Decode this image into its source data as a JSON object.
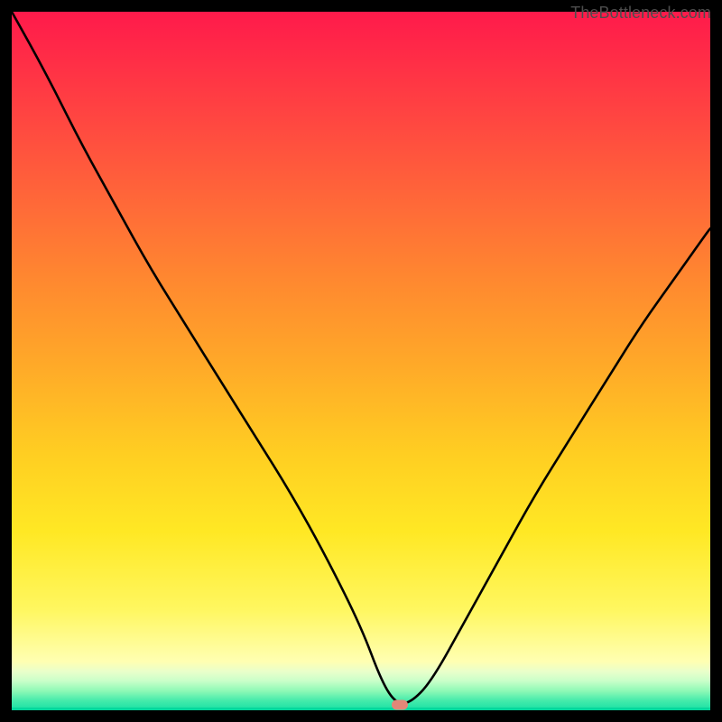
{
  "watermark": "TheBottleneck.com",
  "marker": {
    "x_pct": 55.5,
    "y_pct": 99.2,
    "color": "#e18778"
  },
  "chart_data": {
    "type": "line",
    "title": "",
    "xlabel": "",
    "ylabel": "",
    "xlim": [
      0,
      100
    ],
    "ylim": [
      0,
      100
    ],
    "grid": false,
    "legend": null,
    "series": [
      {
        "name": "bottleneck-curve",
        "x": [
          0,
          5,
          10,
          15,
          20,
          25,
          30,
          35,
          40,
          45,
          50,
          53,
          55,
          57,
          60,
          65,
          70,
          75,
          80,
          85,
          90,
          95,
          100
        ],
        "y": [
          100,
          91,
          81,
          72,
          63,
          55,
          47,
          39,
          31,
          22,
          12,
          4,
          1,
          1,
          4,
          13,
          22,
          31,
          39,
          47,
          55,
          62,
          69
        ]
      }
    ],
    "annotations": [
      {
        "type": "marker",
        "x": 55.5,
        "y": 0.8,
        "shape": "pill",
        "color": "#e18778"
      }
    ],
    "background_gradient": {
      "stops": [
        {
          "pos": 0.0,
          "color": "#ff1a4b"
        },
        {
          "pos": 0.3,
          "color": "#ff6a38"
        },
        {
          "pos": 0.55,
          "color": "#ffab28"
        },
        {
          "pos": 0.8,
          "color": "#ffe824"
        },
        {
          "pos": 0.93,
          "color": "#ffffb2"
        },
        {
          "pos": 0.96,
          "color": "#c9ffc9"
        },
        {
          "pos": 1.0,
          "color": "#18e0a4"
        }
      ]
    }
  }
}
